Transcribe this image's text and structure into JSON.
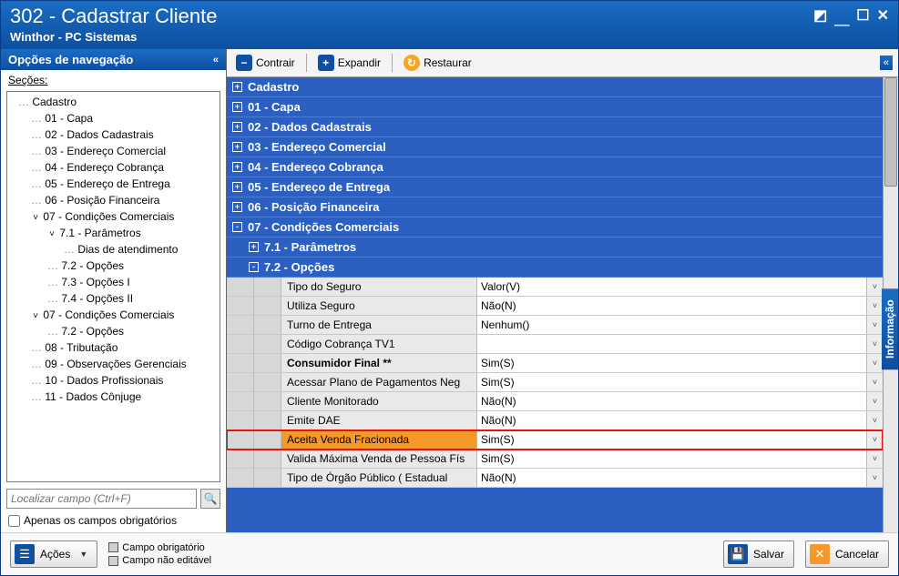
{
  "window": {
    "title": "302 - Cadastrar Cliente",
    "subtitle": "Winthor - PC Sistemas"
  },
  "nav": {
    "header": "Opções de navegação",
    "sections_label": "Seções:",
    "tree": [
      {
        "label": "Cadastro",
        "lvl": 0,
        "caret": ""
      },
      {
        "label": "01 - Capa",
        "lvl": 1,
        "caret": ""
      },
      {
        "label": "02 - Dados Cadastrais",
        "lvl": 1,
        "caret": ""
      },
      {
        "label": "03 - Endereço Comercial",
        "lvl": 1,
        "caret": ""
      },
      {
        "label": "04 - Endereço Cobrança",
        "lvl": 1,
        "caret": ""
      },
      {
        "label": "05 - Endereço de Entrega",
        "lvl": 1,
        "caret": ""
      },
      {
        "label": "06 - Posição Financeira",
        "lvl": 1,
        "caret": ""
      },
      {
        "label": "07 - Condições Comerciais",
        "lvl": 1,
        "caret": "v"
      },
      {
        "label": "7.1 - Parâmetros",
        "lvl": 2,
        "caret": "v"
      },
      {
        "label": "Dias de atendimento",
        "lvl": 3,
        "caret": ""
      },
      {
        "label": "7.2 - Opções",
        "lvl": 2,
        "caret": ""
      },
      {
        "label": "7.3 - Opções I",
        "lvl": 2,
        "caret": ""
      },
      {
        "label": "7.4 - Opções II",
        "lvl": 2,
        "caret": ""
      },
      {
        "label": "07 - Condições Comerciais",
        "lvl": 1,
        "caret": "v"
      },
      {
        "label": "7.2 - Opções",
        "lvl": 2,
        "caret": ""
      },
      {
        "label": "08 - Tributação",
        "lvl": 1,
        "caret": ""
      },
      {
        "label": "09 - Observações Gerenciais",
        "lvl": 1,
        "caret": ""
      },
      {
        "label": "10 - Dados Profissionais",
        "lvl": 1,
        "caret": ""
      },
      {
        "label": "11 - Dados Cônjuge",
        "lvl": 1,
        "caret": ""
      }
    ],
    "search_placeholder": "Localizar campo (Ctrl+F)",
    "only_required": "Apenas os campos obrigatórios"
  },
  "toolbar": {
    "contract": "Contrair",
    "expand": "Expandir",
    "restore": "Restaurar"
  },
  "grid": {
    "categories": [
      {
        "label": "Cadastro",
        "expand": "+",
        "sub": false
      },
      {
        "label": "01 - Capa",
        "expand": "+",
        "sub": false
      },
      {
        "label": "02 - Dados Cadastrais",
        "expand": "+",
        "sub": false
      },
      {
        "label": "03 - Endereço Comercial",
        "expand": "+",
        "sub": false
      },
      {
        "label": "04 - Endereço Cobrança",
        "expand": "+",
        "sub": false
      },
      {
        "label": "05 - Endereço de Entrega",
        "expand": "+",
        "sub": false
      },
      {
        "label": "06 - Posição Financeira",
        "expand": "+",
        "sub": false
      },
      {
        "label": "07 - Condições Comerciais",
        "expand": "-",
        "sub": false
      },
      {
        "label": "7.1 - Parâmetros",
        "expand": "+",
        "sub": true
      },
      {
        "label": "7.2 - Opções",
        "expand": "-",
        "sub": true
      }
    ],
    "props": [
      {
        "name": "Tipo do Seguro",
        "value": "Valor(V)",
        "bold": false,
        "hl": false
      },
      {
        "name": "Utiliza Seguro",
        "value": "Não(N)",
        "bold": false,
        "hl": false
      },
      {
        "name": "Turno de Entrega",
        "value": "Nenhum()",
        "bold": false,
        "hl": false
      },
      {
        "name": "Código Cobrança TV1",
        "value": "",
        "bold": false,
        "hl": false
      },
      {
        "name": "Consumidor Final **",
        "value": "Sim(S)",
        "bold": true,
        "hl": false
      },
      {
        "name": "Acessar Plano de Pagamentos Neg",
        "value": "Sim(S)",
        "bold": false,
        "hl": false
      },
      {
        "name": "Cliente Monitorado",
        "value": "Não(N)",
        "bold": false,
        "hl": false
      },
      {
        "name": "Emite DAE",
        "value": "Não(N)",
        "bold": false,
        "hl": false
      },
      {
        "name": "Aceita Venda Fracionada",
        "value": "Sim(S)",
        "bold": false,
        "hl": true
      },
      {
        "name": "Valida Máxima Venda de Pessoa Fís",
        "value": "Sim(S)",
        "bold": false,
        "hl": false
      },
      {
        "name": "Tipo de Órgão Público ( Estadual",
        "value": "Não(N)",
        "bold": false,
        "hl": false
      }
    ]
  },
  "info_tab": "Informação",
  "footer": {
    "actions": "Ações",
    "legend_required": "Campo obrigatório",
    "legend_readonly": "Campo não editável",
    "save": "Salvar",
    "cancel": "Cancelar"
  }
}
